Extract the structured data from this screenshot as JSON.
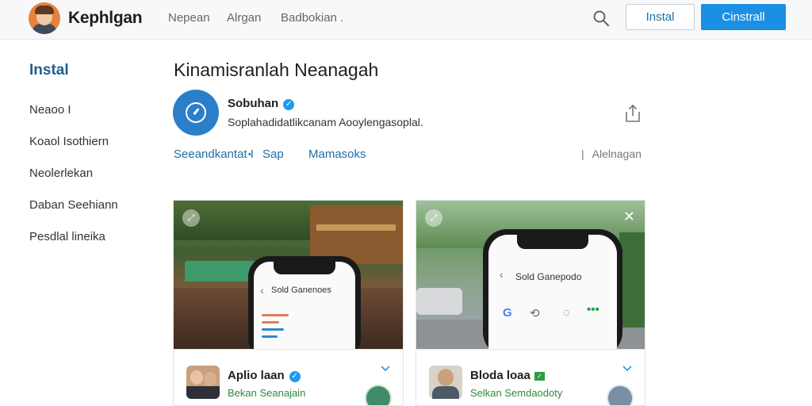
{
  "header": {
    "brand": "Kephlgan",
    "nav": [
      "Nepean",
      "Alrgan",
      "Badbokian ."
    ],
    "install_label": "Instal",
    "primary_label": "Cinstrall"
  },
  "sidebar": {
    "title": "Instal",
    "items": [
      "Neaoo I",
      "Koaol Isothiern",
      "Neolerlekan",
      "Daban Seehiann",
      "Pesdlal lineika"
    ]
  },
  "main": {
    "title": "Kinamisranlah Neanagah",
    "account": {
      "name": "Sobuhan",
      "description": "Soplahadidatlikcanam Aooylengasoplal."
    },
    "tabs": [
      "Seeandkantat I",
      "Sap",
      "Mamasoks"
    ],
    "tab_right": "Alelnagan"
  },
  "cards": [
    {
      "chat_title": "Sold Ganenoes",
      "footer_name": "Aplio laan",
      "footer_sub": "Bekan Seanajain"
    },
    {
      "chat_title": "Sold Ganepodo",
      "footer_name": "Bloda loaa",
      "footer_sub": "Selkan Semdaodoty"
    }
  ],
  "colors": {
    "accent": "#1a8fe3",
    "link": "#1e6fa8",
    "sidebar_title": "#1e5f8f",
    "verified": "#1d9bf0",
    "green_text": "#2e8b3a"
  },
  "icons": {
    "search": "search-icon",
    "share": "share-icon",
    "verified": "verified-badge-icon",
    "close": "close-icon",
    "chevron": "chevron-down-icon"
  }
}
